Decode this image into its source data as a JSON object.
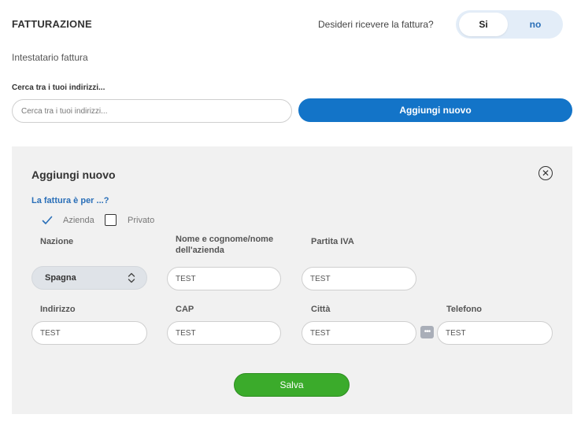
{
  "header": {
    "title": "FATTURAZIONE",
    "question": "Desideri ricevere la fattura?",
    "toggle": {
      "yes_label": "Si",
      "no_label": "no",
      "selected": "Si"
    }
  },
  "subtitle": "Intestatario fattura",
  "search": {
    "label": "Cerca tra i tuoi indirizzi...",
    "placeholder": "Cerca tra i tuoi indirizzi..."
  },
  "add_button_label": "Aggiungi nuovo",
  "panel": {
    "title": "Aggiungi nuovo",
    "close_icon": "close-circle-icon",
    "invoice_for_label": "La fattura è per ...?",
    "options": {
      "azienda": "Azienda",
      "privato": "Privato",
      "selected": "Azienda"
    },
    "labels": {
      "nazione": "Nazione",
      "nome_line1": "Nome e cognome/nome",
      "nome_line2": "dell'azienda",
      "partita_iva": "Partita IVA",
      "indirizzo": "Indirizzo",
      "cap": "CAP",
      "citta": "Città",
      "telefono": "Telefono"
    },
    "values": {
      "nazione": "Spagna",
      "nome": "TEST",
      "partita_iva": "TEST",
      "indirizzo": "TEST",
      "cap": "TEST",
      "citta": "TEST",
      "telefono": "TEST"
    },
    "save_label": "Salva"
  },
  "colors": {
    "accent_blue": "#1374c8",
    "link_blue": "#2a6fb8",
    "save_green": "#3bab2b",
    "panel_bg": "#f1f1f1"
  }
}
